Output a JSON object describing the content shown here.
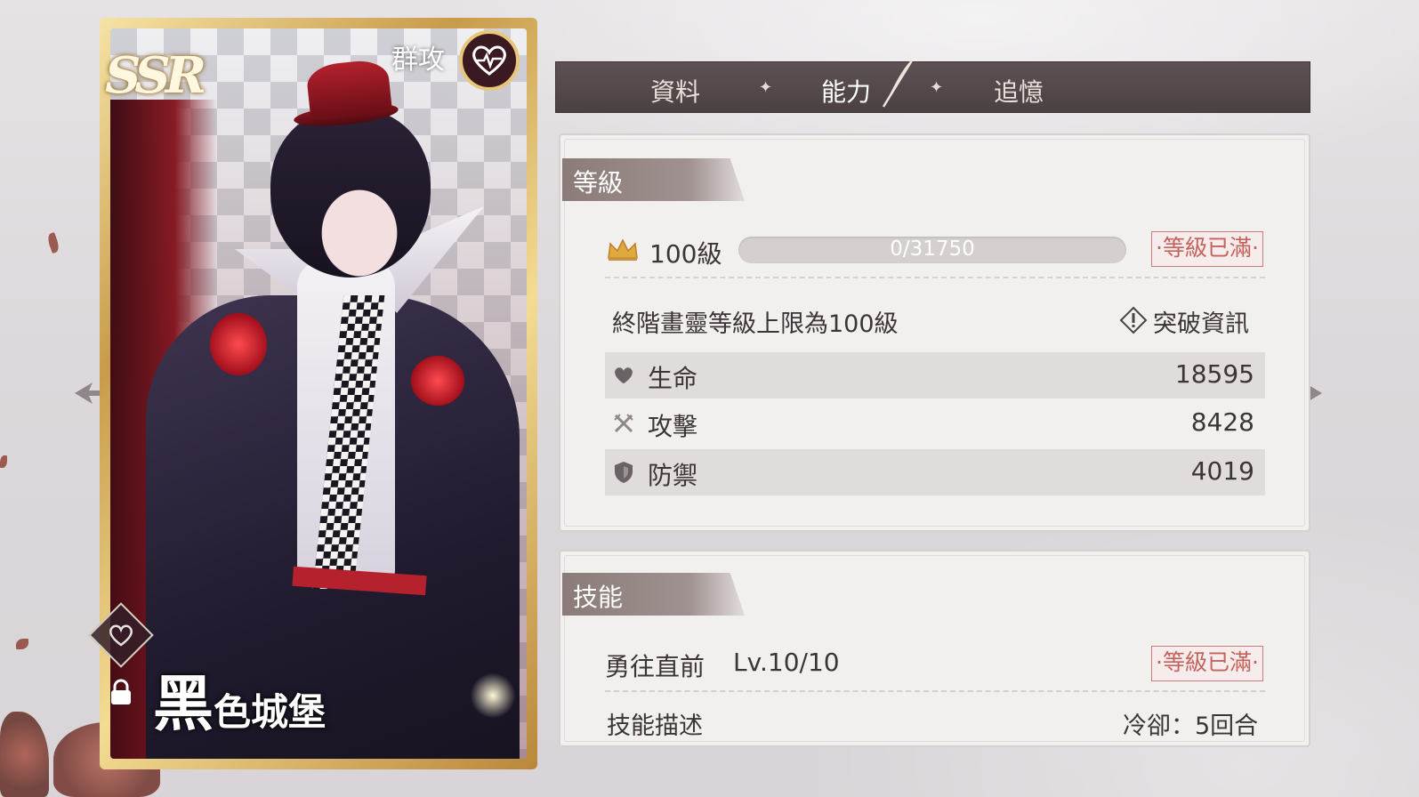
{
  "card": {
    "rarity": "SSR",
    "attack_type": "群攻",
    "name_first": "黑",
    "name_rest": "色城堡"
  },
  "tabs": [
    {
      "label": "資料"
    },
    {
      "label": "能力"
    },
    {
      "label": "追憶"
    }
  ],
  "active_tab": "能力",
  "level_section": {
    "title": "等級",
    "level": "100級",
    "exp": "0/31750",
    "maxed_label": "·等級已滿·",
    "note": "終階畫靈等級上限為100級",
    "breakthrough_label": "突破資訊"
  },
  "stats": [
    {
      "label": "生命",
      "value": "18595",
      "icon": "heart-icon"
    },
    {
      "label": "攻擊",
      "value": "8428",
      "icon": "crossed-swords-icon"
    },
    {
      "label": "防禦",
      "value": "4019",
      "icon": "shield-icon"
    }
  ],
  "skill_section": {
    "title": "技能",
    "skill_name": "勇往直前",
    "skill_level": "Lv.10/10",
    "maxed_label": "·等級已滿·",
    "desc_label": "技能描述",
    "cooldown": "冷卻：5回合"
  },
  "colors": {
    "tab_bar": "#4f4446",
    "panel_bg": "#f2efef",
    "maxed_border": "#c57f79",
    "card_gold": "#d4ad5e"
  }
}
